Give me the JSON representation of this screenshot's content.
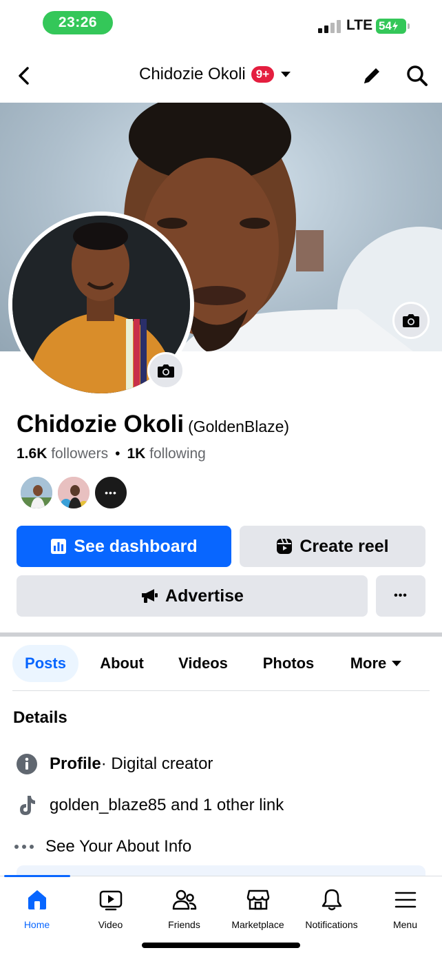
{
  "status_bar": {
    "time": "23:26",
    "network": "LTE",
    "battery": "54"
  },
  "nav": {
    "title": "Chidozie Okoli",
    "badge": "9+"
  },
  "profile": {
    "name": "Chidozie Okoli",
    "alt_name": "(GoldenBlaze)",
    "followers_count": "1.6K",
    "followers_label": "followers",
    "following_count": "1K",
    "following_label": "following",
    "friend_more": "•••"
  },
  "actions": {
    "dashboard": "See dashboard",
    "create_reel": "Create reel",
    "advertise": "Advertise",
    "more": "•••"
  },
  "tabs": [
    "Posts",
    "About",
    "Videos",
    "Photos",
    "More"
  ],
  "details": {
    "title": "Details",
    "profile_label": "Profile",
    "profile_value": " · Digital creator",
    "link": "golden_blaze85 and 1 other link",
    "about": "See Your About Info"
  },
  "bottom_nav": [
    "Home",
    "Video",
    "Friends",
    "Marketplace",
    "Notifications",
    "Menu"
  ],
  "colors": {
    "accent": "#0866ff",
    "badge": "#e41e3f",
    "status_green": "#34c759"
  },
  "icons": [
    "back-icon",
    "pencil-icon",
    "search-icon",
    "camera-icon",
    "dashboard-icon",
    "reel-icon",
    "megaphone-icon",
    "info-icon",
    "tiktok-icon",
    "ellipsis-icon",
    "home-icon",
    "video-icon",
    "friends-icon",
    "marketplace-icon",
    "bell-icon",
    "menu-icon"
  ]
}
